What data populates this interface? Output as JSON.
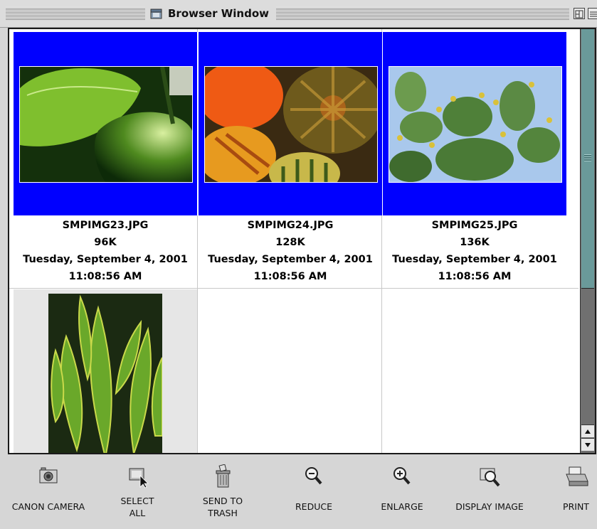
{
  "window": {
    "title": "Browser Window"
  },
  "images": [
    {
      "filename": "SMPIMG23.JPG",
      "size": "96K",
      "date": "Tuesday, September 4, 2001",
      "time": "11:08:56 AM",
      "selected": true
    },
    {
      "filename": "SMPIMG24.JPG",
      "size": "128K",
      "date": "Tuesday, September 4, 2001",
      "time": "11:08:56 AM",
      "selected": true
    },
    {
      "filename": "SMPIMG25.JPG",
      "size": "136K",
      "date": "Tuesday, September 4, 2001",
      "time": "11:08:56 AM",
      "selected": true
    },
    {
      "selected": false
    }
  ],
  "toolbar": {
    "canon_camera": "CANON CAMERA",
    "select_all": "SELECT\nALL",
    "send_to_trash": "SEND TO\nTRASH",
    "reduce": "REDUCE",
    "enlarge": "ENLARGE",
    "display_image": "DISPLAY IMAGE",
    "print": "PRINT"
  },
  "colors": {
    "selection": "#0000ff",
    "scroll_thumb": "#6a9a9a",
    "chrome": "#d6d6d6"
  },
  "icons": {
    "window": "folder-window-icon",
    "canon_camera": "camera-icon",
    "select_all": "select-all-cursor-icon",
    "send_to_trash": "trash-can-icon",
    "reduce": "zoom-out-icon",
    "enlarge": "zoom-in-icon",
    "display_image": "display-image-icon",
    "print": "printer-icon"
  }
}
